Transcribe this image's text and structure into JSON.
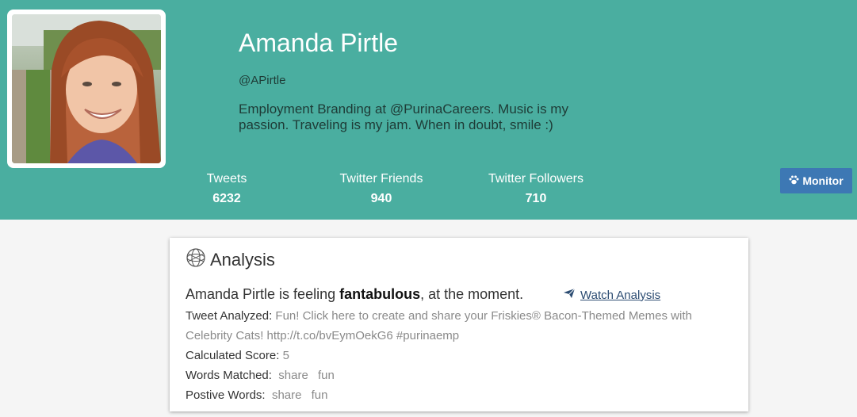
{
  "profile": {
    "name": "Amanda Pirtle",
    "handle": "@APirtle",
    "bio": "Employment Branding at @PurinaCareers. Music is my passion. Traveling is my jam. When in doubt, smile :)"
  },
  "stats": [
    {
      "label": "Tweets",
      "value": "6232"
    },
    {
      "label": "Twitter Friends",
      "value": "940"
    },
    {
      "label": "Twitter Followers",
      "value": "710"
    }
  ],
  "monitor_button": {
    "label": "Monitor",
    "icon": "paw-icon"
  },
  "analysis": {
    "title": "Analysis",
    "feeling_prefix": "Amanda Pirtle is feeling ",
    "feeling_word": "fantabulous",
    "feeling_suffix": ", at the moment.",
    "watch_link": " Watch Analysis",
    "tweet_label": "Tweet Analyzed:",
    "tweet_text": "Fun! Click here to create and share your Friskies® Bacon-Themed Memes with Celebrity Cats! http://t.co/bvEymOekG6 #purinaemp",
    "score_label": "Calculated Score:",
    "score_value": "5",
    "words_label": "Words Matched:",
    "words_matched": [
      "share",
      "fun"
    ],
    "positive_label": "Postive Words:",
    "positive_words": [
      "share",
      "fun"
    ]
  },
  "colors": {
    "header": "#4aaea0",
    "button": "#3d78b4",
    "link": "#2c4c72"
  }
}
